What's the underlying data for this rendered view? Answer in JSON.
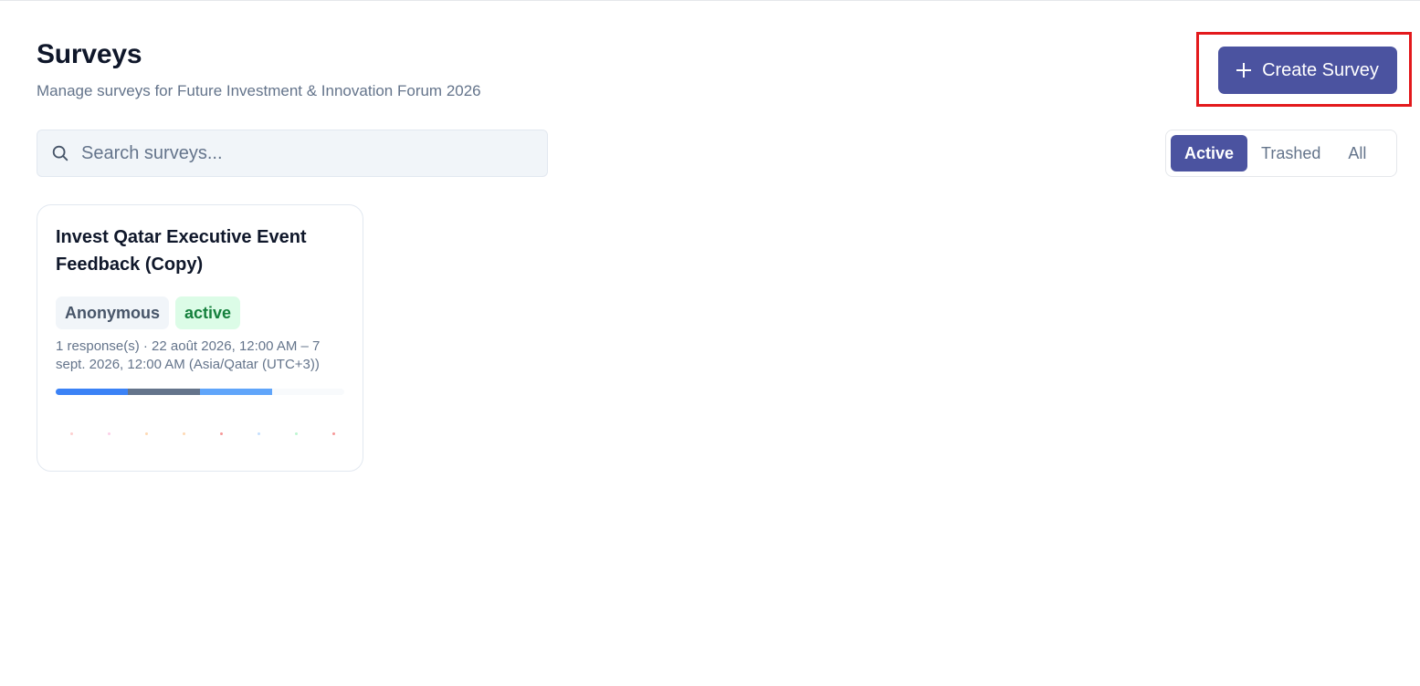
{
  "header": {
    "title": "Surveys",
    "subtitle": "Manage surveys for Future Investment & Innovation Forum 2026",
    "create_button_label": "Create Survey"
  },
  "search": {
    "placeholder": "Search surveys...",
    "value": ""
  },
  "filters": {
    "selected": "Active",
    "options": [
      "Active",
      "Trashed",
      "All"
    ]
  },
  "surveys": [
    {
      "title": "Invest Qatar Executive Event Feedback (Copy)",
      "badges": {
        "anonymity": "Anonymous",
        "status": "active"
      },
      "meta": "1 response(s) · 22 août 2026, 12:00 AM – 7 sept. 2026, 12:00 AM (Asia/Qatar (UTC+3))",
      "progress_segments": [
        {
          "fraction": 0.25,
          "color": "#3b82f6"
        },
        {
          "fraction": 0.25,
          "color": "#64748b"
        },
        {
          "fraction": 0.25,
          "color": "#60a5fa"
        }
      ],
      "dot_colors": [
        "#fca5a5",
        "#f9a8d4",
        "#fdba74",
        "#fdba74",
        "#ef4444",
        "#93c5fd",
        "#86efac",
        "#ef4444"
      ]
    }
  ],
  "colors": {
    "accent": "#4b53a0",
    "highlight_border": "#e3191c",
    "status_active_bg": "#dcfce7",
    "status_active_text": "#15803d"
  }
}
